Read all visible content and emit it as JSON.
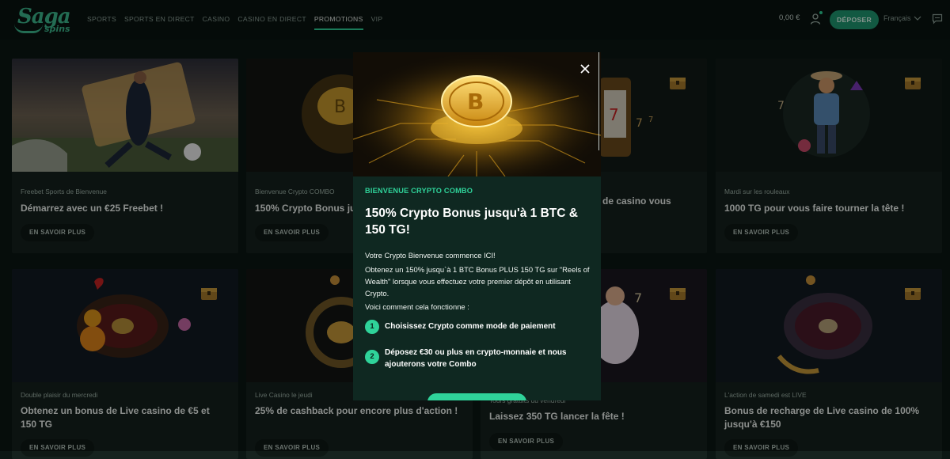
{
  "header": {
    "logo_line1": "Saga",
    "logo_line2": "spins",
    "nav": [
      "SPORTS",
      "SPORTS EN DIRECT",
      "CASINO",
      "CASINO EN DIRECT",
      "PROMOTIONS",
      "VIP"
    ],
    "active_nav": "PROMOTIONS",
    "balance": "0,00 €",
    "deposit_label": "DÉPOSER",
    "language": "Français"
  },
  "cards": [
    {
      "category": "Freebet Sports de Bienvenue",
      "title": "Démarrez avec un €25 Freebet !",
      "button": "EN SAVOIR PLUS"
    },
    {
      "category": "Bienvenue Crypto COMBO",
      "title": "150% Crypto Bonus ju",
      "button": "EN SAVOIR PLUS"
    },
    {
      "category": "",
      "title": "de casino vous",
      "button": ""
    },
    {
      "category": "Mardi sur les rouleaux",
      "title": "1000 TG pour vous faire tourner la tête !",
      "button": "EN SAVOIR PLUS"
    },
    {
      "category": "Double plaisir du mercredi",
      "title": "Obtenez un bonus de Live casino de €5 et 150 TG",
      "button": "EN SAVOIR PLUS"
    },
    {
      "category": "Live Casino le jeudi",
      "title": "25% de cashback pour encore plus d'action !",
      "button": "EN SAVOIR PLUS"
    },
    {
      "category": "Tours gratuits du vendredi",
      "title": "Laissez 350 TG lancer la fête !",
      "button": "EN SAVOIR PLUS"
    },
    {
      "category": "L'action de samedi est LIVE",
      "title": "Bonus de recharge de Live casino de 100% jusqu'à €150",
      "button": "EN SAVOIR PLUS"
    }
  ],
  "modal": {
    "category": "BIENVENUE CRYPTO COMBO",
    "title": "150% Crypto Bonus jusqu'à 1 BTC & 150 TG!",
    "intro": "Votre Crypto Bienvenue commence ICI!",
    "body": "Obtenez un 150% jusqu`à 1 BTC Bonus PLUS 150 TG sur \"Reels of Wealth\" lorsque vous effectuez votre premier dépôt en utilisant Crypto.",
    "how": "Voici comment cela fonctionne :",
    "steps": [
      {
        "num": "1",
        "text": "Choisissez Crypto comme mode de paiement"
      },
      {
        "num": "2",
        "text": "Déposez €30 ou plus en crypto-monnaie et nous ajouterons votre Combo"
      }
    ]
  },
  "colors": {
    "accent": "#2fd39a",
    "deposit": "#1f9a72",
    "background": "#0c1714",
    "card": "#16221e",
    "modal": "#0f2821"
  }
}
